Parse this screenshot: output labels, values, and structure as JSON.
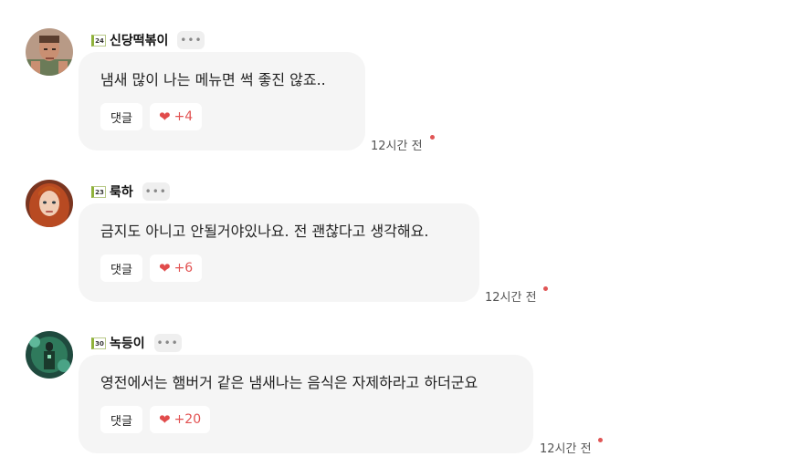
{
  "comments": [
    {
      "level": "24",
      "nickname": "신당떡볶이",
      "more": "•••",
      "text": "냄새 많이 나는 메뉴면 썩 좋진 않죠..",
      "reply_label": "댓글",
      "like_count": "+4",
      "time": "12시간 전"
    },
    {
      "level": "23",
      "nickname": "룩하",
      "more": "•••",
      "text": "금지도 아니고 안될거야있나요. 전 괜찮다고 생각해요.",
      "reply_label": "댓글",
      "like_count": "+6",
      "time": "12시간 전"
    },
    {
      "level": "30",
      "nickname": "녹등이",
      "more": "•••",
      "text": "영전에서는 햄버거 같은 냄새나는 음식은 자제하라고 하더군요",
      "reply_label": "댓글",
      "like_count": "+20",
      "time": "12시간 전"
    }
  ],
  "colors": {
    "like": "#e14b4b",
    "bubble": "#f5f5f5",
    "level_green": "#8fb23a",
    "new_dot": "#e05555"
  }
}
